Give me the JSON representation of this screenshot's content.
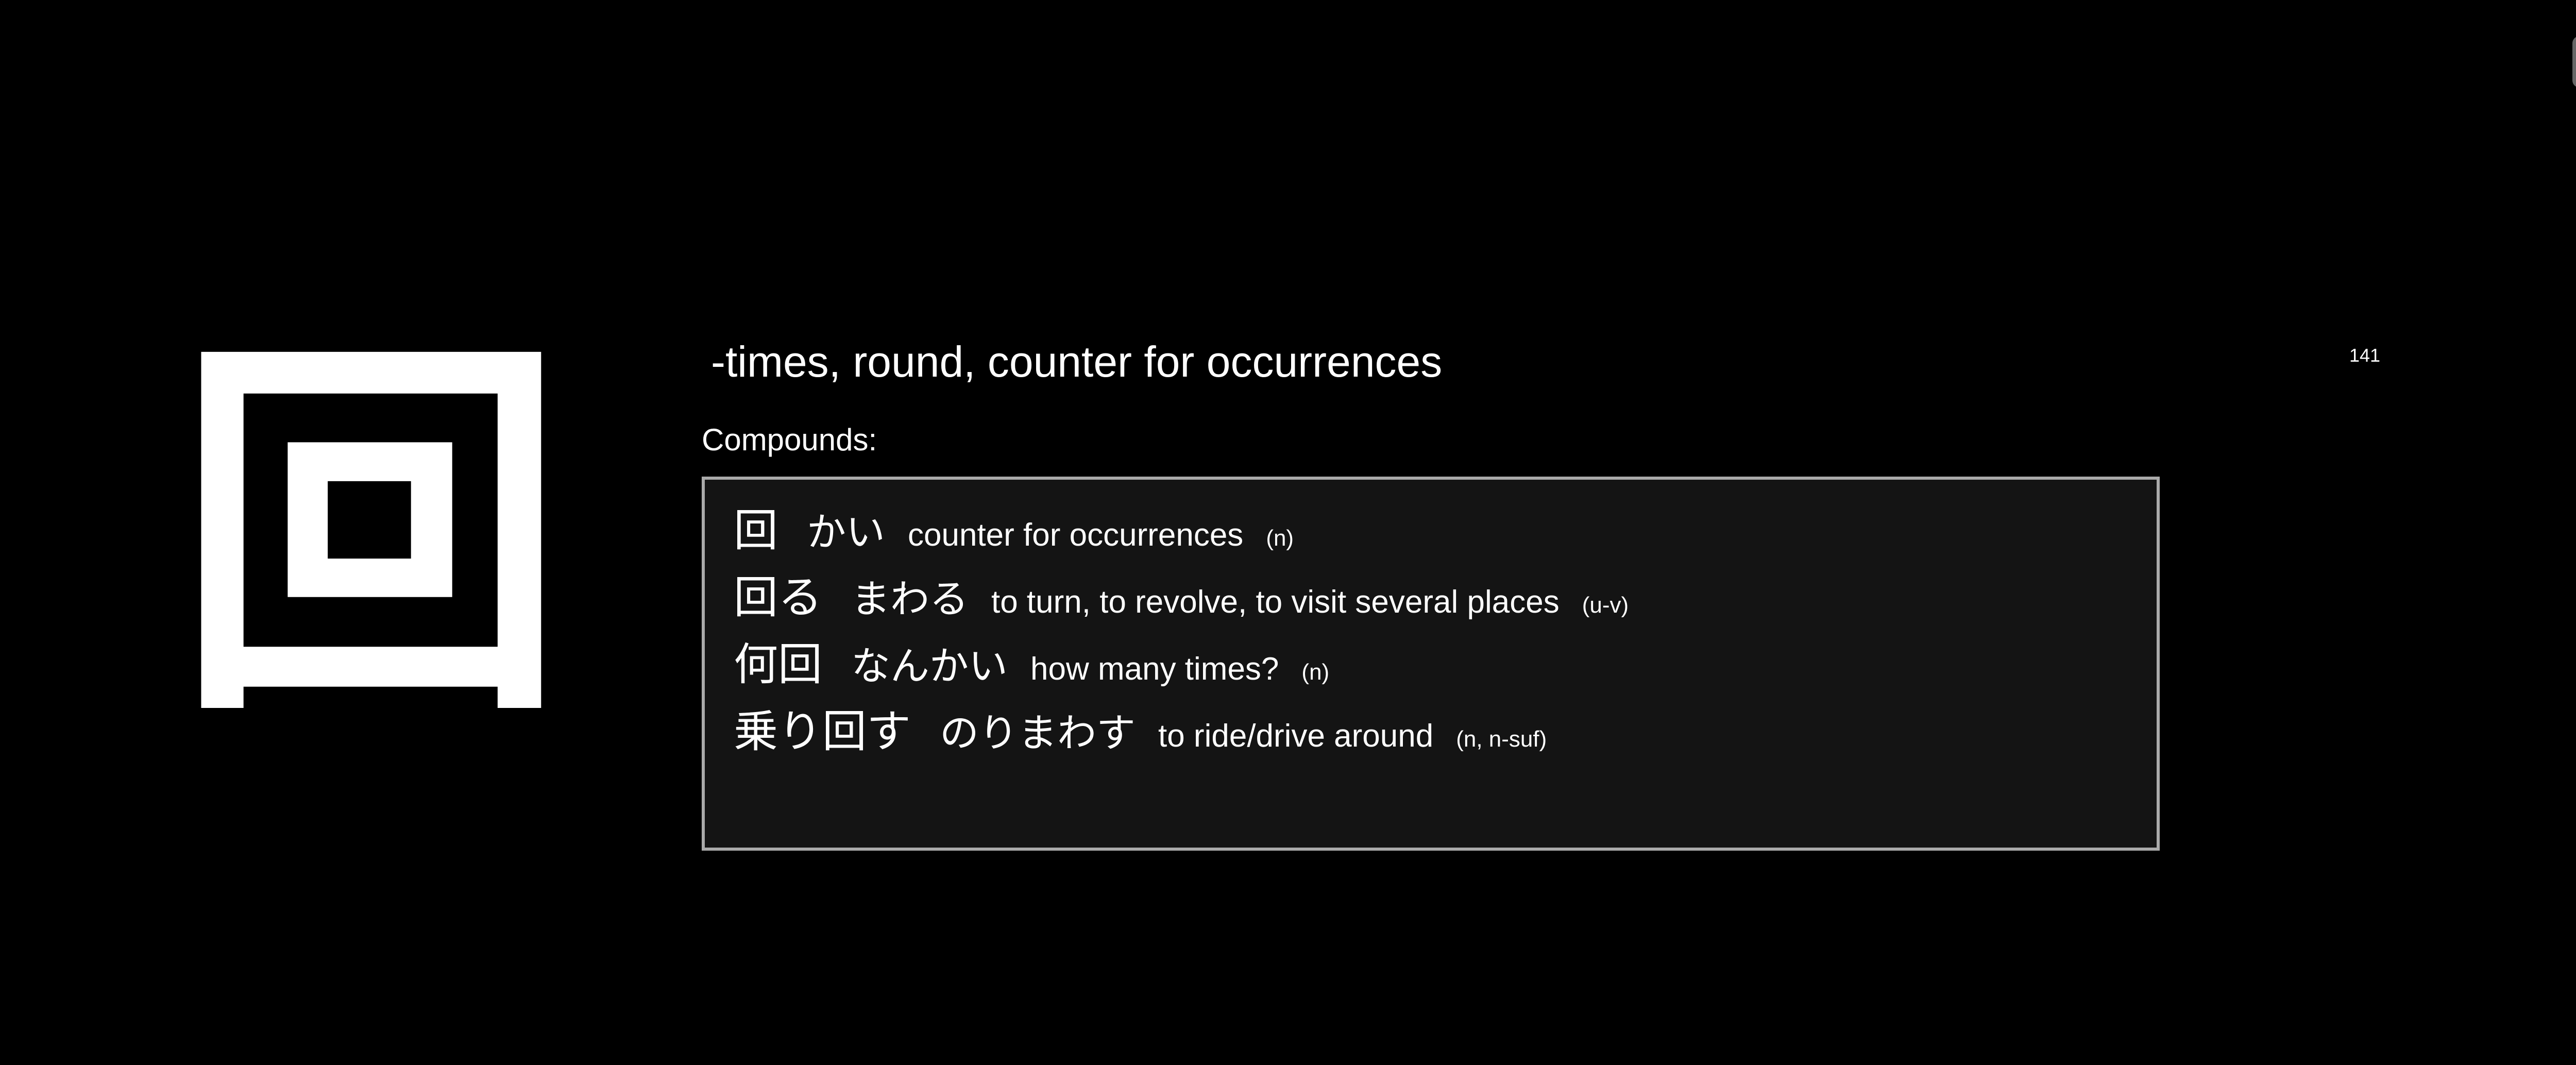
{
  "kanji": "回",
  "meaning": "-times, round, counter for occurrences",
  "stroke_count": "141",
  "compounds_label": "Compounds:",
  "compounds": [
    {
      "word": "回",
      "reading": "かい",
      "gloss": "counter for occurrences",
      "pos": "(n)"
    },
    {
      "word": "回る",
      "reading": "まわる",
      "gloss": "to turn, to revolve, to visit several places",
      "pos": "(u-v)"
    },
    {
      "word": "何回",
      "reading": "なんかい",
      "gloss": "how many times?",
      "pos": "(n)"
    },
    {
      "word": "乗り回す",
      "reading": "のりまわす",
      "gloss": "to ride/drive around",
      "pos": "(n, n-suf)"
    }
  ]
}
